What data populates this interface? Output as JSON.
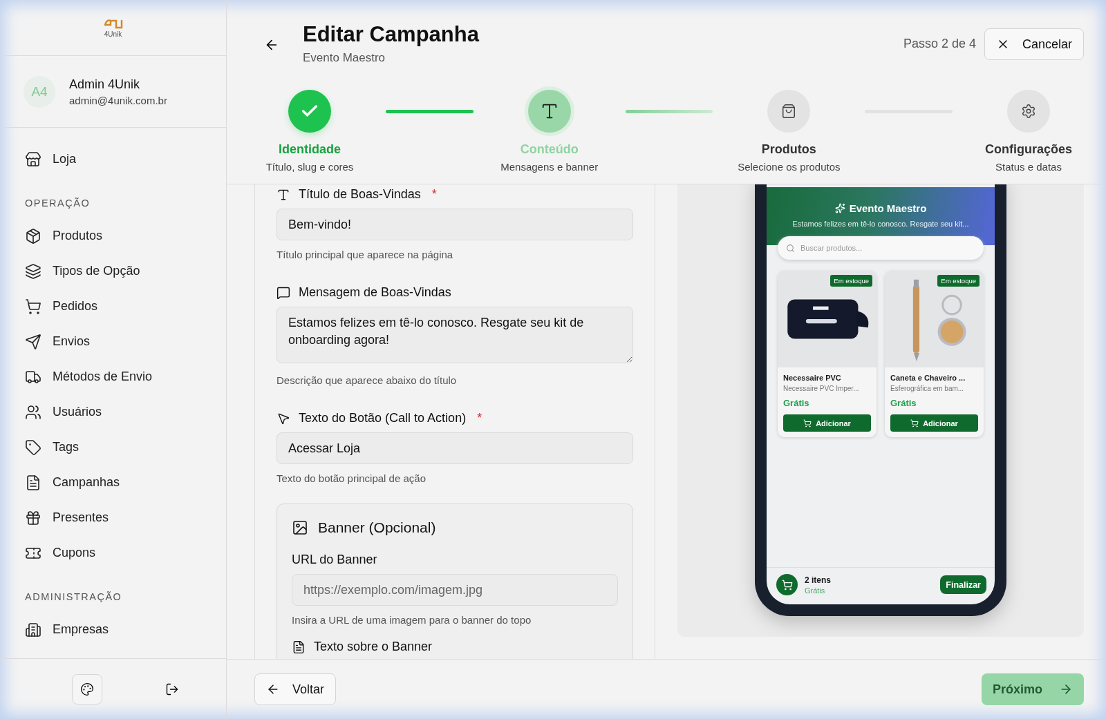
{
  "logo": {
    "text": "4Unik"
  },
  "user": {
    "initials": "A4",
    "name": "Admin 4Unik",
    "email": "admin@4unik.com.br"
  },
  "nav": [
    {
      "kind": "item",
      "label": "Loja"
    },
    {
      "kind": "heading",
      "label": "OPERAÇÃO"
    },
    {
      "kind": "item",
      "label": "Produtos"
    },
    {
      "kind": "item",
      "label": "Tipos de Opção"
    },
    {
      "kind": "item",
      "label": "Pedidos"
    },
    {
      "kind": "item",
      "label": "Envios"
    },
    {
      "kind": "item",
      "label": "Métodos de Envio"
    },
    {
      "kind": "item",
      "label": "Usuários"
    },
    {
      "kind": "item",
      "label": "Tags"
    },
    {
      "kind": "item",
      "label": "Campanhas"
    },
    {
      "kind": "item",
      "label": "Presentes"
    },
    {
      "kind": "item",
      "label": "Cupons"
    },
    {
      "kind": "heading",
      "label": "ADMINISTRAÇÃO"
    },
    {
      "kind": "item",
      "label": "Empresas"
    }
  ],
  "header": {
    "title": "Editar Campanha",
    "subtitle": "Evento Maestro",
    "step_counter": "Passo 2 de 4",
    "cancel": "Cancelar"
  },
  "steps": [
    {
      "title": "Identidade",
      "subtitle": "Título, slug e cores",
      "done": true,
      "selected": false
    },
    {
      "title": "Conteúdo",
      "subtitle": "Mensagens e banner",
      "done": false,
      "selected": true
    },
    {
      "title": "Produtos",
      "subtitle": "Selecione os produtos",
      "done": false,
      "selected": false
    },
    {
      "title": "Configurações",
      "subtitle": "Status e datas",
      "done": false,
      "selected": false
    }
  ],
  "form": {
    "fields": [
      {
        "kind": "input",
        "label": "Título de Boas-Vindas",
        "required_mark": "*",
        "value": "Bem-vindo!",
        "hint": "Título principal que aparece na página"
      },
      {
        "kind": "textarea",
        "label": "Mensagem de Boas-Vindas",
        "value": "Estamos felizes em tê-lo conosco. Resgate seu kit de onboarding agora!",
        "hint": "Descrição que aparece abaixo do título"
      },
      {
        "kind": "input",
        "label": "Texto do Botão (Call to Action)",
        "required_mark": "*",
        "value": "Acessar Loja",
        "hint": "Texto do botão principal de ação"
      }
    ],
    "banner": {
      "title": "Banner (Opcional)",
      "url_label": "URL do Banner",
      "placeholder": "https://exemplo.com/imagem.jpg",
      "hint": "Insira a URL de uma imagem para o banner do topo",
      "text_label": "Texto sobre o Banner"
    }
  },
  "preview": {
    "title": "Evento Maestro",
    "message": "Estamos felizes em tê-lo conosco. Resgate seu kit...",
    "search_placeholder": "Buscar produtos...",
    "products": [
      {
        "name": "Necessaire PVC",
        "description": "Necessaire PVC Imper...",
        "price": "Grátis",
        "badge": "Em estoque",
        "add": "Adicionar",
        "kind": "picture"
      },
      {
        "name": "Caneta e Chaveiro ...",
        "description": "Esferográfica em bam...",
        "price": "Grátis",
        "badge": "Em estoque",
        "add": "Adicionar",
        "kind": "picture"
      }
    ],
    "cart": {
      "count": "2 itens",
      "total": "Grátis",
      "checkout": "Finalizar"
    }
  },
  "footer": {
    "back": "Voltar",
    "next": "Próximo"
  }
}
